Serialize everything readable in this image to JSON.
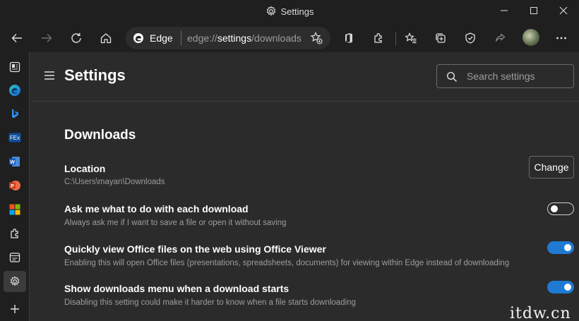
{
  "window": {
    "title": "Settings"
  },
  "toolbar": {
    "address_brand": "Edge",
    "address_url_prefix": "edge://",
    "address_url_main": "settings",
    "address_url_suffix": "/downloads"
  },
  "sidebar": {
    "items": [
      {
        "icon": "collections-icon"
      },
      {
        "icon": "edge-logo-icon"
      },
      {
        "icon": "bing-icon"
      },
      {
        "icon": "fex-icon",
        "text": "FEx"
      },
      {
        "icon": "word-icon",
        "text": "W"
      },
      {
        "icon": "powerpoint-icon",
        "text": "P"
      },
      {
        "icon": "microsoft-logo-icon"
      },
      {
        "icon": "extensions-icon"
      },
      {
        "icon": "browser-essentials-icon"
      },
      {
        "icon": "settings-icon",
        "active": true
      },
      {
        "icon": "add-icon"
      }
    ]
  },
  "header": {
    "title": "Settings",
    "search_placeholder": "Search settings"
  },
  "downloads": {
    "title": "Downloads",
    "location": {
      "label": "Location",
      "path": "C:\\Users\\mayan\\Downloads",
      "button": "Change"
    },
    "settings": [
      {
        "label": "Ask me what to do with each download",
        "desc": "Always ask me if I want to save a file or open it without saving",
        "enabled": false
      },
      {
        "label": "Quickly view Office files on the web using Office Viewer",
        "desc": "Enabling this will open Office files (presentations, spreadsheets, documents) for viewing within Edge instead of downloading",
        "enabled": true
      },
      {
        "label": "Show downloads menu when a download starts",
        "desc": "Disabling this setting could make it harder to know when a file starts downloading",
        "enabled": true
      }
    ]
  },
  "watermark": "itdw.cn",
  "colors": {
    "accent": "#1f7ad4",
    "background": "#2b2b2b",
    "chrome": "#1f1f1f"
  }
}
